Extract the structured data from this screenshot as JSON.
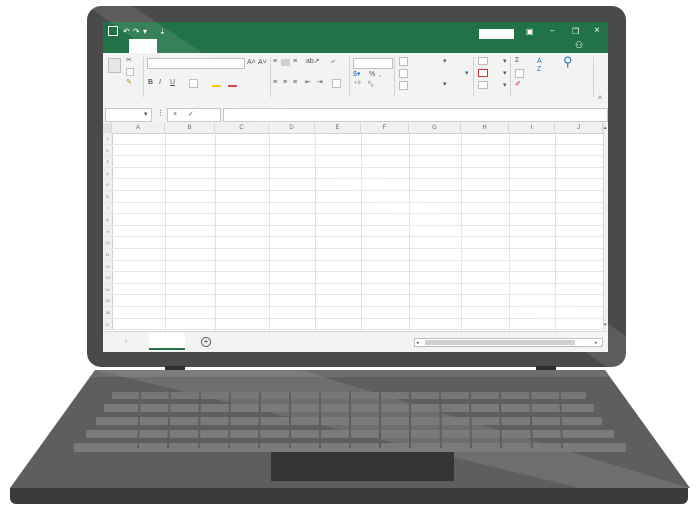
{
  "excel": {
    "window_controls": {
      "restore": "▣",
      "minimize": "–",
      "maximize": "❐",
      "close": "×"
    },
    "ribbon": {
      "bold": "B",
      "italic": "I",
      "underline": "U",
      "percent": "%",
      "sort_a": "A",
      "sort_z": "Z",
      "sigma": "Σ"
    },
    "formula_bar": {
      "cancel": "×",
      "enter": "✓"
    },
    "columns": [
      "A",
      "B",
      "C",
      "D",
      "E",
      "F",
      "G",
      "H",
      "I",
      "J"
    ],
    "rows": [
      "1",
      "2",
      "3",
      "4",
      "5",
      "6",
      "7",
      "8",
      "9",
      "10",
      "11",
      "12",
      "13",
      "14",
      "15",
      "16",
      "17"
    ],
    "add_sheet": "+"
  },
  "colors": {
    "excel_green": "#217346",
    "laptop_body": "#4a4a4a",
    "laptop_deck": "#5e5e5e"
  }
}
